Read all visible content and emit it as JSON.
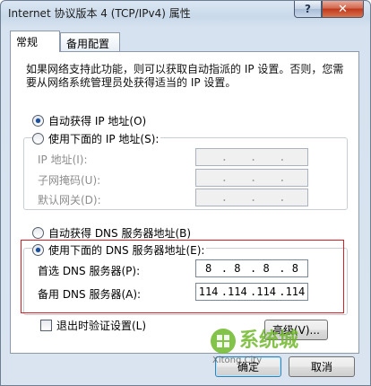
{
  "window": {
    "title": "Internet 协议版本 4 (TCP/IPv4) 属性",
    "help_label": "?",
    "close_label": "✕"
  },
  "tabs": [
    {
      "label": "常规",
      "active": true
    },
    {
      "label": "备用配置",
      "active": false
    }
  ],
  "description": "如果网络支持此功能，则可以获取自动指派的 IP 设置。否则，您需要从网络系统管理员处获得适当的 IP 设置。",
  "ip": {
    "auto_label": "自动获得 IP 地址(O)",
    "manual_label": "使用下面的 IP 地址(S):",
    "selected": "auto",
    "fields": [
      {
        "label": "IP 地址(I):",
        "octets": [
          "",
          "",
          "",
          ""
        ]
      },
      {
        "label": "子网掩码(U):",
        "octets": [
          "",
          "",
          "",
          ""
        ]
      },
      {
        "label": "默认网关(D):",
        "octets": [
          "",
          "",
          "",
          ""
        ]
      }
    ]
  },
  "dns": {
    "auto_label": "自动获得 DNS 服务器地址(B)",
    "manual_label": "使用下面的 DNS 服务器地址(E):",
    "selected": "manual",
    "preferred": {
      "label": "首选 DNS 服务器(P):",
      "octets": [
        "8",
        "8",
        "8",
        "8"
      ]
    },
    "alternate": {
      "label": "备用 DNS 服务器(A):",
      "octets": [
        "114",
        "114",
        "114",
        "114"
      ]
    }
  },
  "validate_checkbox": {
    "label": "退出时验证设置(L)",
    "checked": false
  },
  "buttons": {
    "advanced": "高级(V)...",
    "ok": "确定",
    "cancel": "取消"
  },
  "watermark": {
    "brand": "系统城",
    "site": "Xitong City"
  },
  "colors": {
    "highlight_box": "#d21e24",
    "radio_dot": "#1b4f9a",
    "watermark_green": "#6fb82a"
  }
}
